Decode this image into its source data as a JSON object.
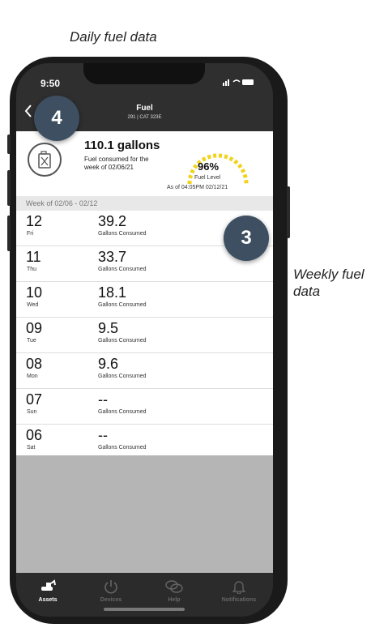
{
  "captions": {
    "top": "Daily fuel data",
    "side": "Weekly fuel data"
  },
  "status_bar": {
    "time": "9:50"
  },
  "header": {
    "back_icon": "chevron-left-icon",
    "title": "Fuel",
    "subtitle": "291 | CAT 323E"
  },
  "summary": {
    "icon": "jerrycan-icon",
    "gallons": "110.1 gallons",
    "description": "Fuel consumed for the week of 02/06/21",
    "fuel_level_pct": "96%",
    "fuel_level_value": 0.96,
    "fuel_level_label": "Fuel Level",
    "as_of": "As of 04:05PM 02/12/21",
    "gauge_color": "#f2d21b"
  },
  "week_header": "Week of 02/06 - 02/12",
  "rows": [
    {
      "day": "12",
      "dow": "Fri",
      "value": "39.2",
      "label": "Gallons Consumed"
    },
    {
      "day": "11",
      "dow": "Thu",
      "value": "33.7",
      "label": "Gallons Consumed"
    },
    {
      "day": "10",
      "dow": "Wed",
      "value": "18.1",
      "label": "Gallons Consumed"
    },
    {
      "day": "09",
      "dow": "Tue",
      "value": "9.5",
      "label": "Gallons Consumed"
    },
    {
      "day": "08",
      "dow": "Mon",
      "value": "9.6",
      "label": "Gallons Consumed"
    },
    {
      "day": "07",
      "dow": "Sun",
      "value": "--",
      "label": "Gallons Consumed"
    },
    {
      "day": "06",
      "dow": "Sat",
      "value": "--",
      "label": "Gallons Consumed"
    }
  ],
  "tabs": [
    {
      "label": "Assets",
      "icon": "excavator-icon",
      "active": true
    },
    {
      "label": "Devices",
      "icon": "power-icon",
      "active": false
    },
    {
      "label": "Help",
      "icon": "chat-bubbles-icon",
      "active": false
    },
    {
      "label": "Notifications",
      "icon": "bell-icon",
      "active": false
    }
  ],
  "badges": {
    "four": "4",
    "three": "3",
    "color": "#3d4f61"
  }
}
